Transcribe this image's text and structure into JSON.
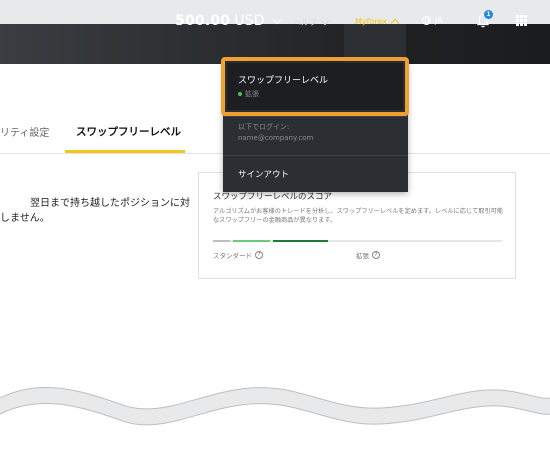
{
  "navbar": {
    "balance_amount": "500.00",
    "balance_currency": "USD",
    "help_label": "ヘルプ",
    "myforex_label": "Myforex",
    "language": "JA",
    "notification_count": "1"
  },
  "tabs": {
    "previous_label": "リティ設定",
    "active_label": "スワップフリーレベル"
  },
  "main": {
    "description_line1": "翌日まで持ち越したポジションに対",
    "description_line2": "しません。"
  },
  "score_card": {
    "title": "スワップフリーレベルのスコア",
    "description": "アルゴリズムがお客様のトレードを分析し、スワップフリーレベルを定めます。レベルに応じて取引可能なスワップフリーの金融商品が異なります。",
    "label_standard": "スタンダード",
    "label_extended": "拡張"
  },
  "dropdown": {
    "swapfree_title": "スワップフリーレベル",
    "swapfree_level": "拡張",
    "logged_in_as": "以下でログイン:",
    "email": "name@company.com",
    "sign_out": "サインアウト"
  },
  "colors": {
    "accent_yellow": "#f5c518",
    "highlight_orange": "#f0a030",
    "level_green": "#1f7a3a",
    "level_light_green": "#6ccb7a",
    "dropdown_bg": "#2b2e32"
  }
}
